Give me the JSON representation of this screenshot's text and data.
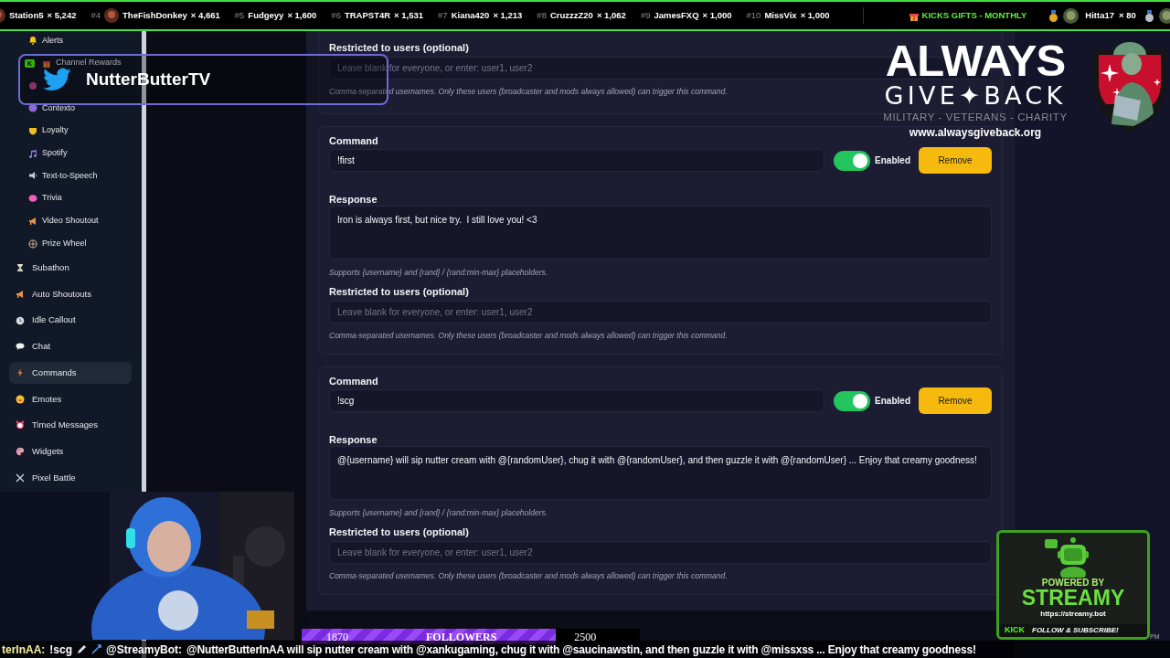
{
  "leaderboard": {
    "entries": [
      {
        "name": "Station5",
        "amount": "× 5,242",
        "avatar": true
      },
      {
        "rank": "#4",
        "name": "TheFishDonkey",
        "amount": "× 4,661",
        "avatar": true
      },
      {
        "rank": "#5",
        "name": "Fudgeyy",
        "amount": "× 1,600",
        "avatar": false
      },
      {
        "rank": "#6",
        "name": "TRAPST4R",
        "amount": "× 1,531",
        "avatar": false
      },
      {
        "rank": "#7",
        "name": "Kiana420",
        "amount": "× 1,213",
        "avatar": false
      },
      {
        "rank": "#8",
        "name": "CruzzzZ20",
        "amount": "× 1,062",
        "avatar": false
      },
      {
        "rank": "#9",
        "name": "JamesFXQ",
        "amount": "× 1,000",
        "avatar": false
      },
      {
        "rank": "#10",
        "name": "MissVix",
        "amount": "× 1,000",
        "avatar": false
      }
    ],
    "gifts_title": "KICKS GIFTS - MONTHLY",
    "monthly": [
      {
        "color": "#e8a820",
        "name": "Hitta17",
        "amount": "× 80"
      },
      {
        "color": "#b8c0c8"
      }
    ]
  },
  "sidebar": {
    "sub_items": [
      {
        "label": "Alerts"
      },
      {
        "label": "Channel Rewards",
        "badge": "K"
      },
      {
        "label_hidden": true
      },
      {
        "label": "Contexto"
      },
      {
        "label": "Loyalty"
      },
      {
        "label": "Spotify"
      },
      {
        "label": "Text-to-Speech"
      },
      {
        "label": "Trivia"
      },
      {
        "label": "Video Shoutout"
      },
      {
        "label": "Prize Wheel"
      }
    ],
    "items": [
      {
        "label": "Subathon",
        "selected": false
      },
      {
        "label": "Auto Shoutouts",
        "selected": false
      },
      {
        "label": "Idle Callout",
        "selected": false
      },
      {
        "label": "Chat",
        "selected": false
      },
      {
        "label": "Commands",
        "selected": true
      },
      {
        "label": "Emotes",
        "selected": false
      },
      {
        "label": "Timed Messages",
        "selected": false
      },
      {
        "label": "Widgets",
        "selected": false
      },
      {
        "label": "Pixel Battle",
        "selected": false
      }
    ]
  },
  "name_overlay": {
    "name": "NutterButterTV"
  },
  "cards": [
    {
      "kind": "partial",
      "restricted_label": "Restricted to users (optional)",
      "restricted_placeholder": "Leave blank for everyone, or enter: user1, user2",
      "restricted_help": "Comma-separated usernames. Only these users (broadcaster and mods always allowed) can trigger this command."
    },
    {
      "kind": "full",
      "command_label": "Command",
      "command": "!first",
      "enabled": true,
      "enabled_label": "Enabled",
      "remove": "Remove",
      "response_label": "Response",
      "response": "Iron is always first, but nice try.  I still love you! <3",
      "response_help": "Supports {username} and {rand} / {rand:min-max} placeholders.",
      "restricted_label": "Restricted to users (optional)",
      "restricted_placeholder": "Leave blank for everyone, or enter: user1, user2",
      "restricted_help": "Comma-separated usernames. Only these users (broadcaster and mods always allowed) can trigger this command."
    },
    {
      "kind": "full",
      "command_label": "Command",
      "command": "!scg",
      "enabled": true,
      "enabled_label": "Enabled",
      "remove": "Remove",
      "response_label": "Response",
      "response": "@{username} will sip nutter cream with @{randomUser}, chug it with @{randomUser}, and then guzzle it with @{randomUser} ... Enjoy that creamy goodness!",
      "response_help": "Supports {username} and {rand} / {rand:min-max} placeholders.",
      "restricted_label": "Restricted to users (optional)",
      "restricted_placeholder": "Leave blank for everyone, or enter: user1, user2",
      "restricted_help": "Comma-separated usernames. Only these users (broadcaster and mods always allowed) can trigger this command."
    }
  ],
  "charity_logo": {
    "line1": "ALWAYS",
    "line2": "GIVE✦BACK",
    "tagline": "MILITARY - VETERANS - CHARITY",
    "url": "www.alwaysgiveback.org"
  },
  "followers_goal": {
    "current": "1870",
    "label": "FOLLOWERS",
    "goal": "2500",
    "level": 0.75
  },
  "streamy_badge": {
    "powered": "POWERED BY",
    "brand": "STREAMY",
    "url": "https://streamy.bot",
    "platform": "KICK",
    "cta": "FOLLOW & SUBSCRIBE!"
  },
  "clock": "PM",
  "chat_ticker": {
    "user": "terInAA:",
    "message": "!scg",
    "bot": "@StreamyBot:",
    "reply": "@NutterButterInAA will sip nutter cream with @xankugaming, chug it with @saucinawstin, and then guzzle it with @missxss ... Enjoy that creamy goodness!"
  }
}
